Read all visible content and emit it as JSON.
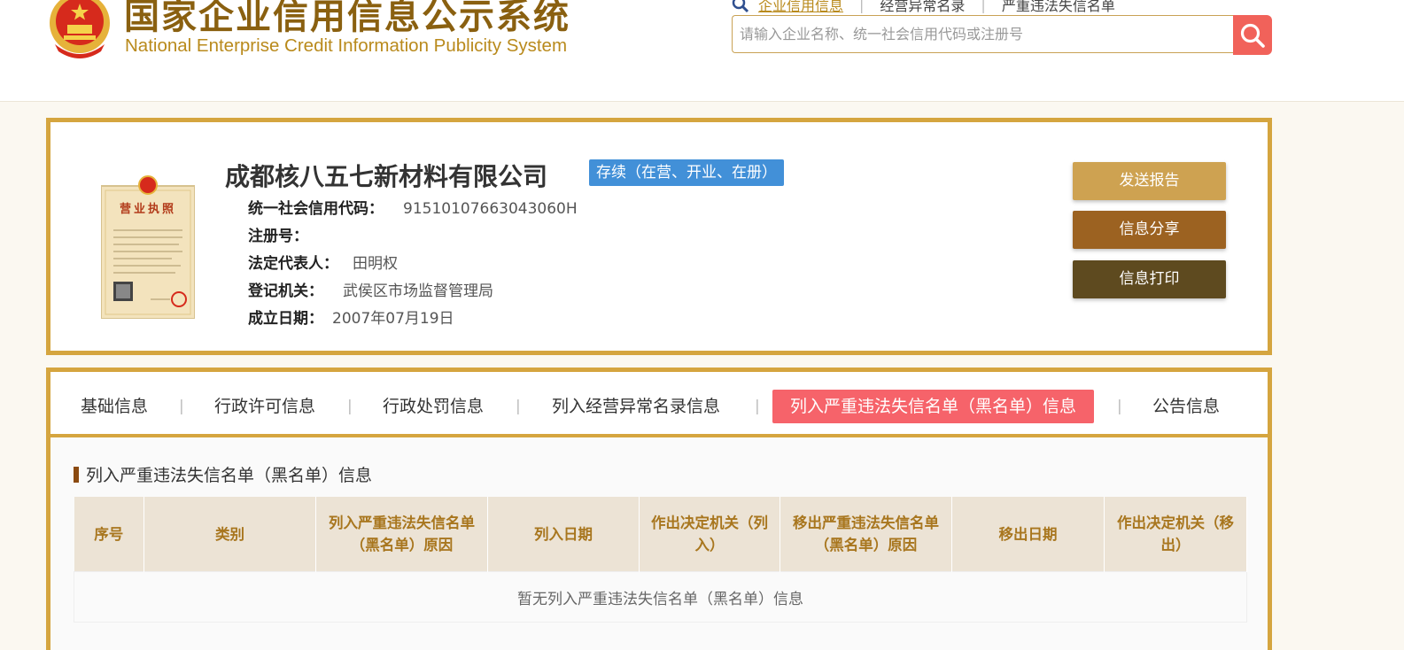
{
  "header": {
    "title_cn": "国家企业信用信息公示系统",
    "title_en": "National Enterprise Credit Information Publicity System",
    "nav_links": [
      "企业信用信息",
      "经营异常名录",
      "严重违法失信名单"
    ],
    "search_placeholder": "请输入企业名称、统一社会信用代码或注册号"
  },
  "company": {
    "name": "成都核八五七新材料有限公司",
    "status": "存续（在营、开业、在册）",
    "fields": [
      {
        "label": "统一社会信用代码：",
        "value": "91510107663043060H"
      },
      {
        "label": "注册号：",
        "value": ""
      },
      {
        "label": "法定代表人：",
        "value": "田明权"
      },
      {
        "label": "登记机关：",
        "value": "武侯区市场监督管理局"
      },
      {
        "label": "成立日期：",
        "value": "2007年07月19日"
      }
    ],
    "license_text": "营业执照"
  },
  "actions": {
    "send_report": "发送报告",
    "share": "信息分享",
    "print": "信息打印"
  },
  "tabs": [
    "基础信息",
    "行政许可信息",
    "行政处罚信息",
    "列入经营异常名录信息",
    "列入严重违法失信名单（黑名单）信息",
    "公告信息"
  ],
  "active_tab": 4,
  "section": {
    "title": "列入严重违法失信名单（黑名单）信息",
    "columns": [
      "序号",
      "类别",
      "列入严重违法失信名单（黑名单）原因",
      "列入日期",
      "作出决定机关（列入）",
      "移出严重违法失信名单（黑名单）原因",
      "移出日期",
      "作出决定机关（移出）"
    ],
    "empty_message": "暂无列入严重违法失信名单（黑名单）信息"
  },
  "colors": {
    "gold_border": "#d5a53f",
    "search_button": "#f1625a",
    "status_badge": "#4290d8",
    "active_tab": "#f6636a"
  }
}
